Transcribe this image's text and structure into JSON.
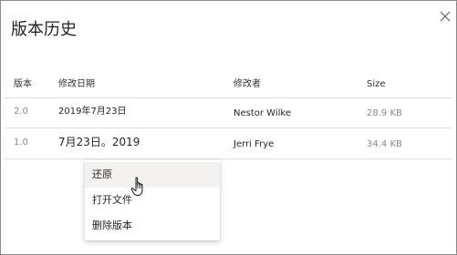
{
  "dialog": {
    "title": "版本历史",
    "close_icon": "close-icon"
  },
  "table": {
    "headers": [
      "版本",
      "修改日期",
      "修改者",
      "Size"
    ],
    "rows": [
      {
        "version": "2.0",
        "modified": "2019年7月23日",
        "modified_by": "Nestor Wilke",
        "size": "28.9 KB"
      },
      {
        "version": "1.0",
        "modified": "7月23日。2019",
        "modified_by": "Jerri Frye",
        "size": "34.4 KB"
      }
    ]
  },
  "context_menu": {
    "items": [
      "还原",
      "打开文件",
      "删除版本"
    ],
    "highlighted_item": "还原"
  },
  "colors": {
    "accent_hover": "#f3f2f1",
    "muted_text": "#8a8886",
    "border": "#8a8a8a"
  },
  "icons": {
    "close": "close-icon",
    "cursor": "hand-pointer-icon"
  }
}
